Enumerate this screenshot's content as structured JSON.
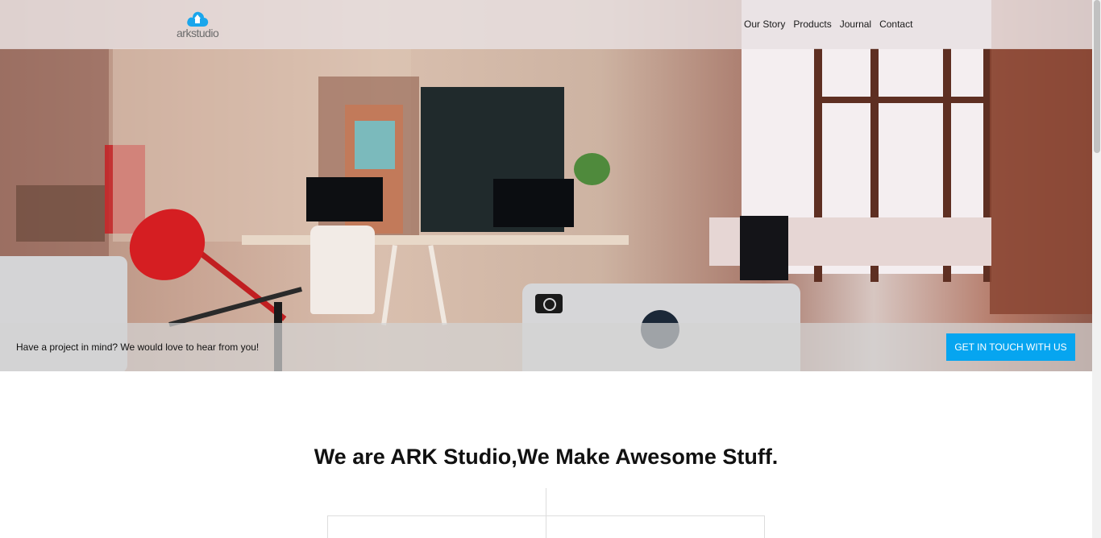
{
  "brand": {
    "logo_text": "arkstudio",
    "logo_icon": "cloud-upload-icon",
    "accent": "#06a5f0"
  },
  "nav": {
    "items": [
      {
        "label": "Our Story"
      },
      {
        "label": "Products"
      },
      {
        "label": "Journal"
      },
      {
        "label": "Contact"
      }
    ]
  },
  "hero": {
    "image": "office-workspace-photo",
    "cta_text": "Have a project in mind? We would love to hear from you!",
    "cta_button": "GET IN TOUCH WITH US"
  },
  "main": {
    "headline": "We are ARK Studio,We Make Awesome Stuff."
  }
}
